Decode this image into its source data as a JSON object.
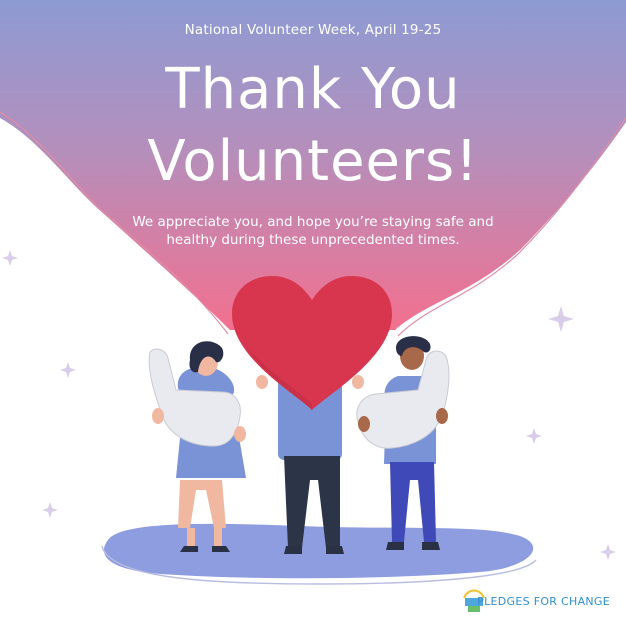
{
  "poster": {
    "event_line": "National Volunteer Week, April 19-25",
    "title_line1": "Thank You",
    "title_line2": "Volunteers!",
    "message": "We appreciate you, and hope you’re staying safe and healthy during these unprecedented times.",
    "organization": "PLEDGES FOR CHANGE"
  },
  "colors": {
    "banner_top": "#8e9bd2",
    "banner_bottom": "#f07493",
    "heart": "#d8364e",
    "ground": "#8e9de0",
    "shirt": "#7891d4",
    "brand_text": "#2f8fd2"
  },
  "icons": [
    "sparkle-icon",
    "heart-icon",
    "hand-icon",
    "pledges-logo-icon"
  ]
}
